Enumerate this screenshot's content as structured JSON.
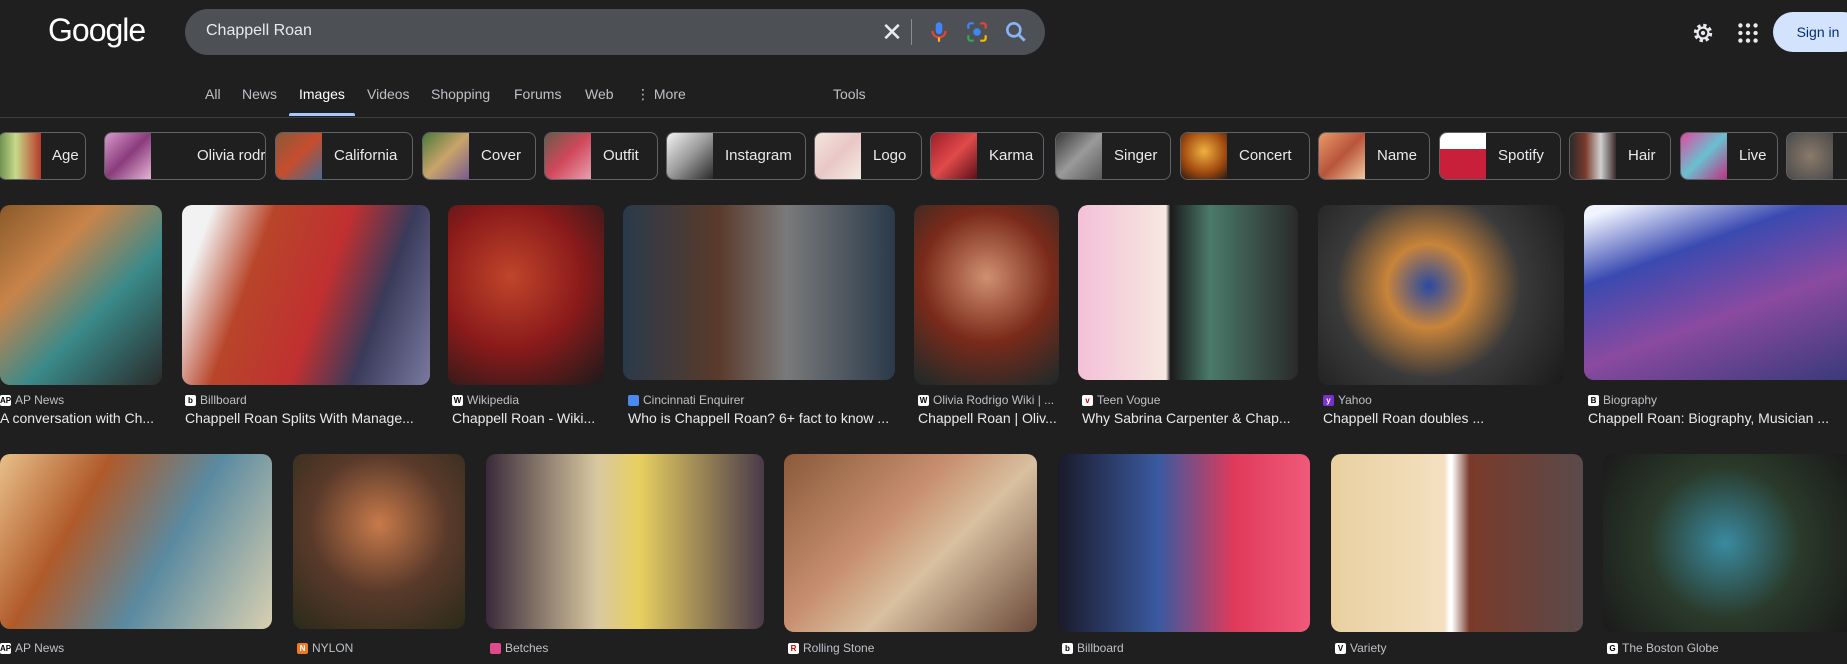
{
  "header": {
    "logo": "Google",
    "search_value": "Chappell Roan",
    "signin_label": "Sign in"
  },
  "tabs": [
    {
      "label": "All"
    },
    {
      "label": "News"
    },
    {
      "label": "Images",
      "active": true
    },
    {
      "label": "Videos"
    },
    {
      "label": "Shopping"
    },
    {
      "label": "Forums"
    },
    {
      "label": "Web"
    },
    {
      "label": "⋮ More"
    },
    {
      "label": "Tools"
    }
  ],
  "chips": [
    {
      "label": "Age"
    },
    {
      "label": "Olivia rodrigo"
    },
    {
      "label": "California"
    },
    {
      "label": "Cover"
    },
    {
      "label": "Outfit"
    },
    {
      "label": "Instagram"
    },
    {
      "label": "Logo"
    },
    {
      "label": "Karma"
    },
    {
      "label": "Singer"
    },
    {
      "label": "Concert"
    },
    {
      "label": "Name"
    },
    {
      "label": "Spotify"
    },
    {
      "label": "Hair"
    },
    {
      "label": "Live"
    }
  ],
  "row1": [
    {
      "source": "AP News",
      "title": "A conversation with Ch..."
    },
    {
      "source": "Billboard",
      "title": "Chappell Roan Splits With Manage..."
    },
    {
      "source": "Wikipedia",
      "title": "Chappell Roan - Wiki..."
    },
    {
      "source": "Cincinnati Enquirer",
      "title": "Who is Chappell Roan? 6+ fact to know ..."
    },
    {
      "source": "Olivia Rodrigo Wiki | ...",
      "title": "Chappell Roan | Oliv..."
    },
    {
      "source": "Teen Vogue",
      "title": "Why Sabrina Carpenter & Chap..."
    },
    {
      "source": "Yahoo",
      "title": "Chappell Roan doubles ..."
    },
    {
      "source": "Biography",
      "title": "Chappell Roan: Biography, Musician ..."
    }
  ],
  "row2": [
    {
      "source": "AP News"
    },
    {
      "source": "NYLON"
    },
    {
      "source": "Betches"
    },
    {
      "source": "Rolling Stone"
    },
    {
      "source": "Billboard"
    },
    {
      "source": "Variety"
    },
    {
      "source": "The Boston Globe"
    }
  ]
}
